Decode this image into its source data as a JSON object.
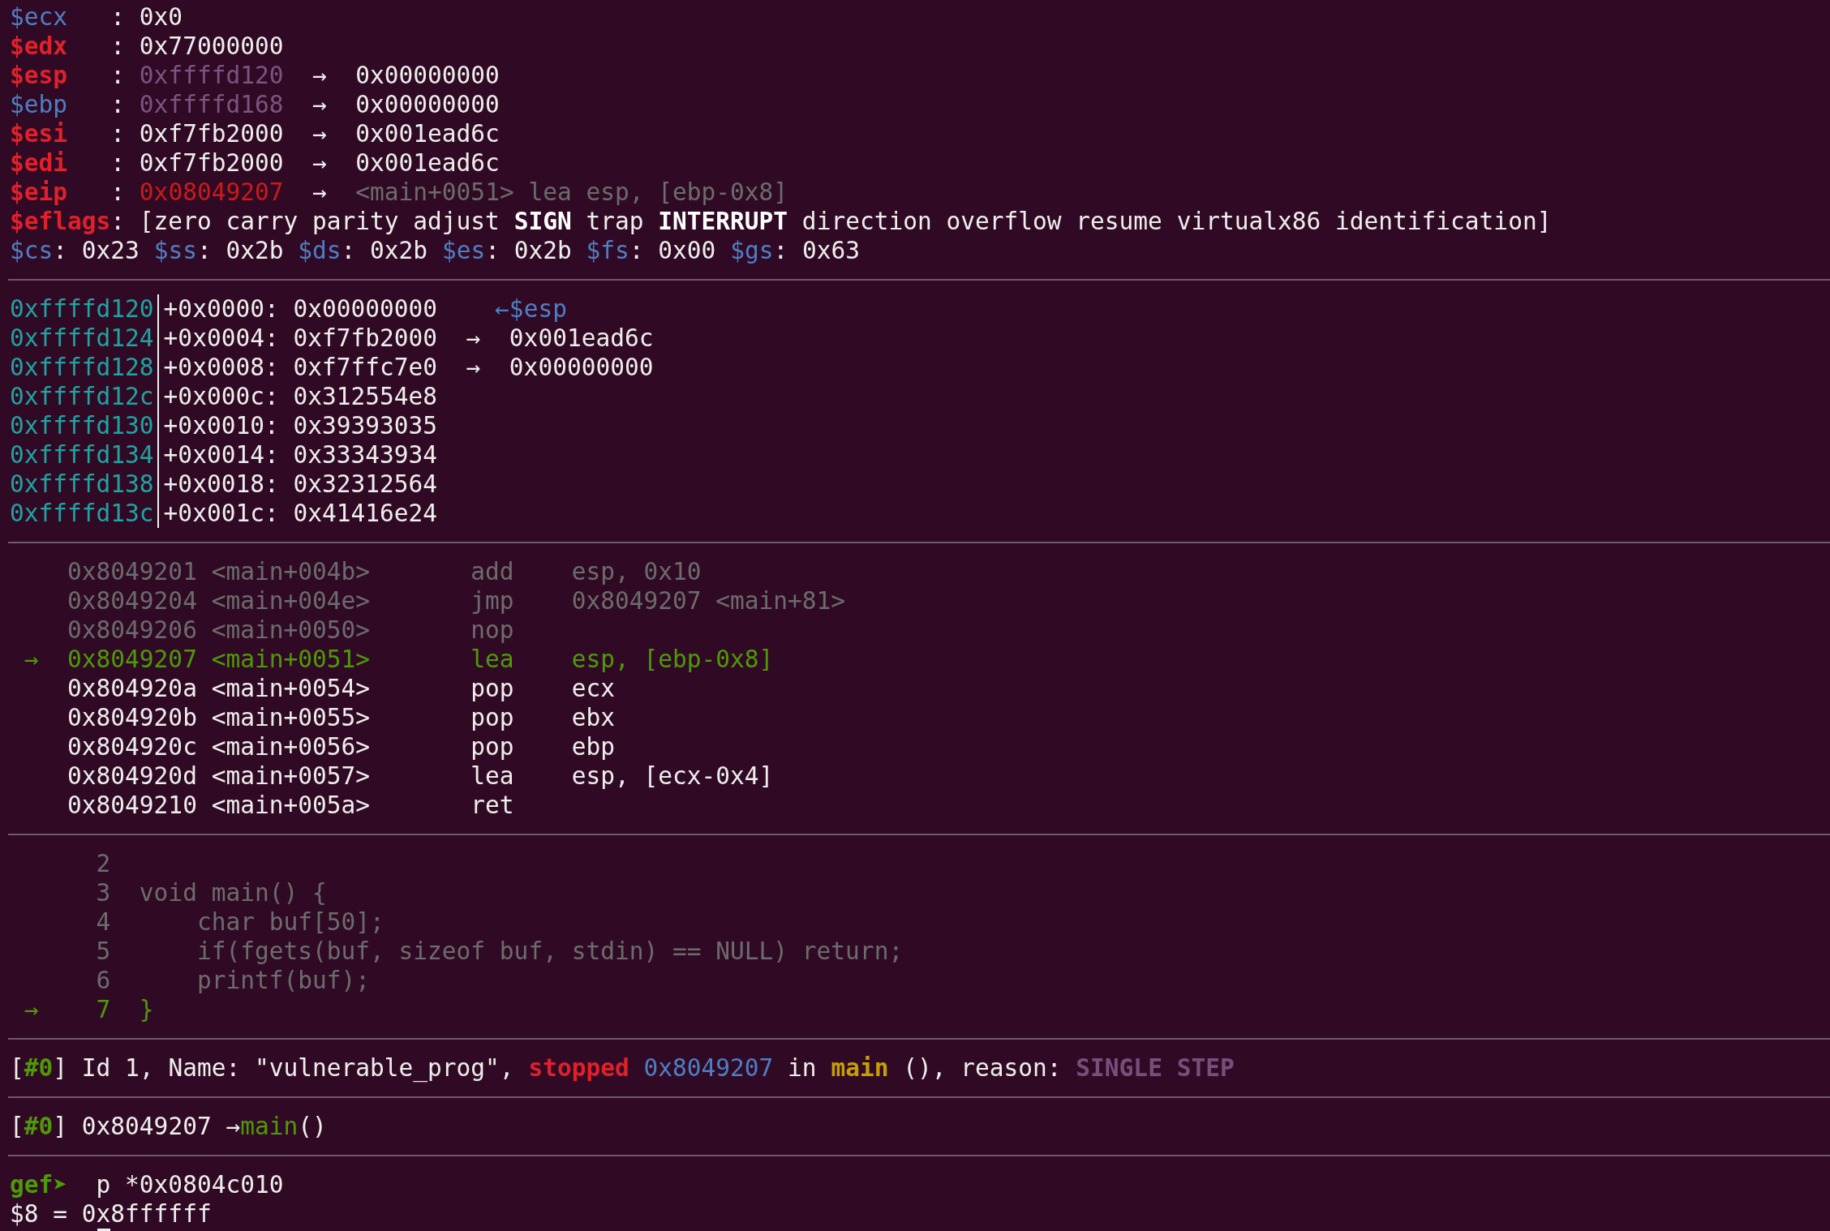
{
  "sections": [
    {
      "kind": "registers",
      "lines": [
        [
          {
            "kind": "reg",
            "text": "$ecx"
          },
          {
            "kind": "plain",
            "text": "   : 0x0"
          }
        ],
        [
          {
            "kind": "changed",
            "text": "$edx"
          },
          {
            "kind": "plain",
            "text": "   : 0x77000000"
          }
        ],
        [
          {
            "kind": "changed",
            "text": "$esp"
          },
          {
            "kind": "plain",
            "text": "   : "
          },
          {
            "kind": "ptr",
            "text": "0xffffd120"
          },
          {
            "kind": "plain",
            "text": "  →  0x00000000"
          }
        ],
        [
          {
            "kind": "reg",
            "text": "$ebp"
          },
          {
            "kind": "plain",
            "text": "   : "
          },
          {
            "kind": "ptr",
            "text": "0xffffd168"
          },
          {
            "kind": "plain",
            "text": "  →  0x00000000"
          }
        ],
        [
          {
            "kind": "changed",
            "text": "$esi"
          },
          {
            "kind": "plain",
            "text": "   : 0xf7fb2000  →  0x001ead6c"
          }
        ],
        [
          {
            "kind": "changed",
            "text": "$edi"
          },
          {
            "kind": "plain",
            "text": "   : 0xf7fb2000  →  0x001ead6c"
          }
        ],
        [
          {
            "kind": "changed",
            "text": "$eip"
          },
          {
            "kind": "plain",
            "text": "   : "
          },
          {
            "kind": "code_ptr",
            "text": "0x08049207"
          },
          {
            "kind": "plain",
            "text": "  →  "
          },
          {
            "kind": "old",
            "text": "<main+0051> lea esp, [ebp-0x8]"
          }
        ],
        [
          {
            "kind": "changed",
            "text": "$eflags"
          },
          {
            "kind": "plain",
            "text": ": [zero carry parity adjust "
          },
          {
            "kind": "bold",
            "text": "SIGN"
          },
          {
            "kind": "plain",
            "text": " trap "
          },
          {
            "kind": "bold",
            "text": "INTERRUPT"
          },
          {
            "kind": "plain",
            "text": " direction overflow resume virtualx86 identification]"
          }
        ],
        [
          {
            "kind": "reg",
            "text": "$cs"
          },
          {
            "kind": "plain",
            "text": ": 0x23 "
          },
          {
            "kind": "reg",
            "text": "$ss"
          },
          {
            "kind": "plain",
            "text": ": 0x2b "
          },
          {
            "kind": "reg",
            "text": "$ds"
          },
          {
            "kind": "plain",
            "text": ": 0x2b "
          },
          {
            "kind": "reg",
            "text": "$es"
          },
          {
            "kind": "plain",
            "text": ": 0x2b "
          },
          {
            "kind": "reg",
            "text": "$fs"
          },
          {
            "kind": "plain",
            "text": ": 0x00 "
          },
          {
            "kind": "reg",
            "text": "$gs"
          },
          {
            "kind": "plain",
            "text": ": 0x63"
          }
        ]
      ]
    },
    {
      "kind": "stack",
      "lines": [
        [
          {
            "kind": "stack_addr",
            "text": "0xffffd120"
          },
          {
            "kind": "plain",
            "text": "+0x0000: 0x00000000    "
          },
          {
            "kind": "reg",
            "text": "←$esp"
          }
        ],
        [
          {
            "kind": "stack_addr",
            "text": "0xffffd124"
          },
          {
            "kind": "plain",
            "text": "+0x0004: 0xf7fb2000  →  0x001ead6c"
          }
        ],
        [
          {
            "kind": "stack_addr",
            "text": "0xffffd128"
          },
          {
            "kind": "plain",
            "text": "+0x0008: 0xf7ffc7e0  →  0x00000000"
          }
        ],
        [
          {
            "kind": "stack_addr",
            "text": "0xffffd12c"
          },
          {
            "kind": "plain",
            "text": "+0x000c: 0x312554e8"
          }
        ],
        [
          {
            "kind": "stack_addr",
            "text": "0xffffd130"
          },
          {
            "kind": "plain",
            "text": "+0x0010: 0x39393035"
          }
        ],
        [
          {
            "kind": "stack_addr",
            "text": "0xffffd134"
          },
          {
            "kind": "plain",
            "text": "+0x0014: 0x33343934"
          }
        ],
        [
          {
            "kind": "stack_addr",
            "text": "0xffffd138"
          },
          {
            "kind": "plain",
            "text": "+0x0018: 0x32312564"
          }
        ],
        [
          {
            "kind": "stack_addr",
            "text": "0xffffd13c"
          },
          {
            "kind": "plain",
            "text": "+0x001c: 0x41416e24"
          }
        ]
      ]
    },
    {
      "kind": "code",
      "lines": [
        [
          {
            "kind": "old",
            "text": "    0x8049201 <main+004b>       add    esp, 0x10"
          }
        ],
        [
          {
            "kind": "old",
            "text": "    0x8049204 <main+004e>       jmp    0x8049207 <main+81>"
          }
        ],
        [
          {
            "kind": "old",
            "text": "    0x8049206 <main+0050>       nop"
          }
        ],
        [
          {
            "kind": "current",
            "text": " →  0x8049207 <main+0051>       lea    esp, [ebp-0x8]"
          }
        ],
        [
          {
            "kind": "plain",
            "text": "    0x804920a <main+0054>       pop    ecx"
          }
        ],
        [
          {
            "kind": "plain",
            "text": "    0x804920b <main+0055>       pop    ebx"
          }
        ],
        [
          {
            "kind": "plain",
            "text": "    0x804920c <main+0056>       pop    ebp"
          }
        ],
        [
          {
            "kind": "plain",
            "text": "    0x804920d <main+0057>       lea    esp, [ecx-0x4]"
          }
        ],
        [
          {
            "kind": "plain",
            "text": "    0x8049210 <main+005a>       ret"
          }
        ]
      ]
    },
    {
      "kind": "source",
      "lines": [
        [
          {
            "kind": "src",
            "text": "      2"
          }
        ],
        [
          {
            "kind": "src",
            "text": "      3  void main() {"
          }
        ],
        [
          {
            "kind": "src",
            "text": "      4      char buf[50];"
          }
        ],
        [
          {
            "kind": "src",
            "text": "      5      if(fgets(buf, sizeof buf, stdin) == NULL) return;"
          }
        ],
        [
          {
            "kind": "src",
            "text": "      6      printf(buf);"
          }
        ],
        [
          {
            "kind": "current",
            "text": " →    7  }"
          }
        ]
      ]
    },
    {
      "kind": "threads",
      "lines": [
        [
          {
            "kind": "plain",
            "text": "["
          },
          {
            "kind": "frame",
            "text": "#0"
          },
          {
            "kind": "plain",
            "text": "] Id 1, Name: \"vulnerable_prog\", "
          },
          {
            "kind": "stopped",
            "text": "stopped"
          },
          {
            "kind": "reg",
            "text": "0x8049207"
          },
          {
            "kind": "plain",
            "text": " in "
          },
          {
            "kind": "fn",
            "text": "main"
          },
          {
            "kind": "plain",
            "text": " (), reason: "
          },
          {
            "kind": "reason",
            "text": "SINGLE STEP"
          }
        ]
      ]
    },
    {
      "kind": "trace",
      "lines": [
        [
          {
            "kind": "plain",
            "text": "["
          },
          {
            "kind": "frame",
            "text": "#0"
          },
          {
            "kind": "plain",
            "text": "] 0x8049207 →"
          },
          {
            "kind": "green",
            "text": "main"
          },
          {
            "kind": "plain",
            "text": "()"
          }
        ]
      ]
    },
    {
      "kind": "prompt",
      "lines": [
        [
          {
            "kind": "frame",
            "text": "gef➤"
          },
          {
            "kind": "plain",
            "text": "  p *0x0804c010"
          }
        ],
        [
          {
            "kind": "plain",
            "text": "$8 = 0x8ffffff"
          }
        ]
      ]
    }
  ]
}
